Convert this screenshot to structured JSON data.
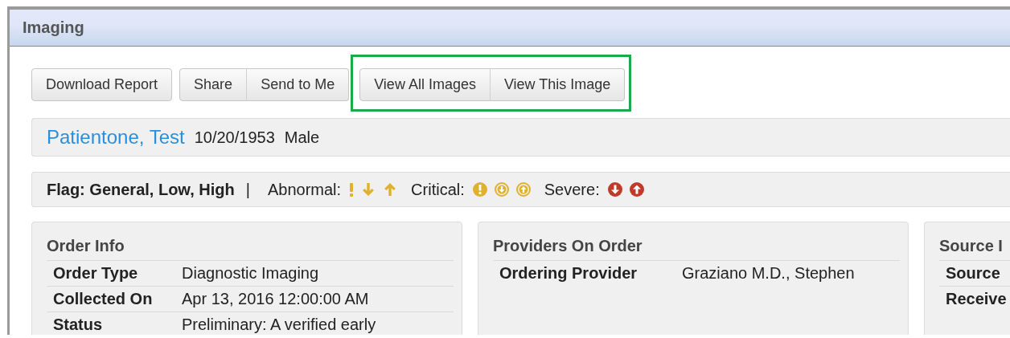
{
  "window": {
    "title": "Imaging"
  },
  "toolbar": {
    "groups": [
      {
        "highlighted": false,
        "buttons": [
          "Download Report"
        ]
      },
      {
        "highlighted": false,
        "buttons": [
          "Share",
          "Send to Me"
        ]
      },
      {
        "highlighted": true,
        "buttons": [
          "View All Images",
          "View This Image"
        ]
      }
    ]
  },
  "patient": {
    "name": "Patientone, Test",
    "birth_date": "10/20/1953",
    "sex": "Male"
  },
  "flag_bar": {
    "label": "Flag: General, Low, High",
    "separator": "|",
    "legends": [
      {
        "label": "Abnormal:",
        "color": "#e0b12e",
        "icons": [
          {
            "kind": "bang"
          },
          {
            "kind": "down"
          },
          {
            "kind": "up"
          }
        ]
      },
      {
        "label": "Critical:",
        "color": "#e0b12e",
        "icons": [
          {
            "kind": "solid-bang"
          },
          {
            "kind": "ring-down"
          },
          {
            "kind": "ring-up"
          }
        ]
      },
      {
        "label": "Severe:",
        "color": "#c0392b",
        "icons": [
          {
            "kind": "solid-down"
          },
          {
            "kind": "solid-up"
          }
        ]
      }
    ]
  },
  "cards": [
    {
      "title": "Order Info",
      "rows": [
        {
          "label": "Order Type",
          "value": "Diagnostic Imaging"
        },
        {
          "label": "Collected On",
          "value": "Apr 13, 2016 12:00:00 AM"
        },
        {
          "label": "Status",
          "value": "Preliminary: A verified early"
        }
      ]
    },
    {
      "title": "Providers On Order",
      "rows": [
        {
          "label": "Ordering Provider",
          "value": "Graziano M.D., Stephen"
        }
      ]
    },
    {
      "title": "Source I",
      "rows": [
        {
          "label": "Source"
        },
        {
          "label": "Receive"
        }
      ]
    }
  ]
}
